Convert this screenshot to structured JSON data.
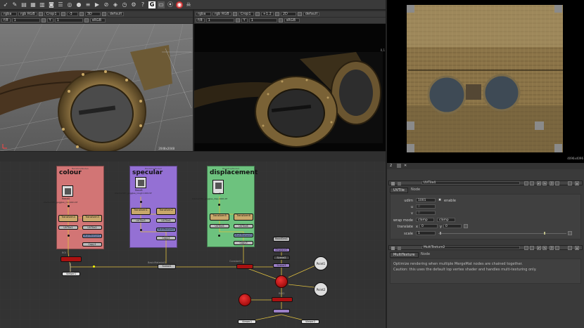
{
  "toolbar": {
    "icons": [
      "pointer-icon",
      "pen-icon",
      "layers-icon",
      "grid-icon",
      "table-icon",
      "camera-icon",
      "list-icon",
      "globe-icon",
      "circle-icon",
      "bars-icon",
      "play-icon",
      "no-icon",
      "node-icon",
      "clock-icon",
      "settings-icon",
      "help-icon",
      "g-icon",
      "panel-icon",
      "target-icon",
      "record-icon",
      "skull-icon"
    ],
    "g_label": "G"
  },
  "viewer1": {
    "channels": "rgba",
    "rgb": "rgb RGB",
    "crop": "Crop1",
    "proxy": "-3",
    "mode": "3D",
    "lut": "default",
    "row2_frame": "f/8",
    "row2_val": "1",
    "row2_y": "Y",
    "row2_1": "1",
    "colorspace": "sRGB",
    "bbox_label": "2048x2048"
  },
  "viewer2": {
    "channels": "rgba",
    "rgb": "rgb RGB",
    "crop": "Crop1",
    "proxy": "+1.2",
    "mode": "2D",
    "lut": "default",
    "row2_frame": "f/8",
    "row2_val": "1",
    "row2_y": "Y",
    "row2_1": "1",
    "colorspace": "sRGB",
    "corner_label": "0,1"
  },
  "viewer3": {
    "corner_label": "4096x4096"
  },
  "nodegraph": {
    "backdrops": [
      {
        "label": "BackdropNode1",
        "title": "colour",
        "color": "#d07070"
      },
      {
        "label": "BackdropNode2",
        "title": "specular",
        "color": "#8f6fd0"
      },
      {
        "label": "BackdropNode3",
        "title": "displacement",
        "color": "#6fc07f"
      }
    ],
    "reads": [
      "Read4",
      "Read1",
      "Read5"
    ],
    "read_paths": [
      "blacksmith_goggles_col.1001.tif",
      "blacksmith_goggles_rough.1001.tif",
      "blacksmith_goggles_disp.1001.tif"
    ],
    "transform_labels": [
      "Transform4",
      "Transform3",
      "Transform1",
      "Transform2",
      "Transform5",
      "Transform6"
    ],
    "frame_labels": [
      "(frame 1)",
      "(frame 2)"
    ],
    "uvtile_labels": [
      "UVTile1",
      "UVTile2",
      "UVTile3",
      "UVTile4",
      "UVTile5",
      "UVTile6"
    ],
    "multi_labels": [
      "MultiTexture1",
      "MultiTexture2",
      "MultiTexture3"
    ],
    "copy_labels": [
      "Copy1",
      "Copy2",
      "Copy3"
    ],
    "roi_labels": [
      "ROI",
      "ROI2"
    ],
    "viewer_labels": [
      "Viewer1",
      "Viewer1",
      "Viewer2"
    ],
    "readgeo": "ReadGeo1",
    "scene_labels": [
      "Scene1",
      "Scene2",
      "Scene3"
    ],
    "point_labels": [
      "Point1",
      "Point2"
    ],
    "mat_labels": [
      "BasicMaterial1",
      "Constant1",
      "Displace1"
    ]
  },
  "props": {
    "tab_number": "2",
    "uvtile": {
      "name": "UVTile4",
      "tabs": [
        "UVTile",
        "Node"
      ],
      "udim_label": "udim",
      "udim_value": "1001",
      "enable_label": "enable",
      "u_label": "u",
      "u_value": "0",
      "v_label": "v",
      "v_value": "0",
      "wrap_label": "wrap mode",
      "wrap_u": "clamp",
      "wrap_v": "clamp",
      "translate_label": "translate",
      "tx_label": "x",
      "tx_value": "0",
      "ty_label": "y",
      "ty_value": "0",
      "scale_label": "scale",
      "scale_value": "1"
    },
    "multitexture": {
      "name": "MultiTexture2",
      "tabs": [
        "MultiTexture",
        "Node"
      ],
      "desc1": "Optimize rendering when multiple MergeMat nodes are chained together.",
      "desc2": "Caution: this uses the default lop vertex shader and handles multi-texturing only."
    }
  }
}
